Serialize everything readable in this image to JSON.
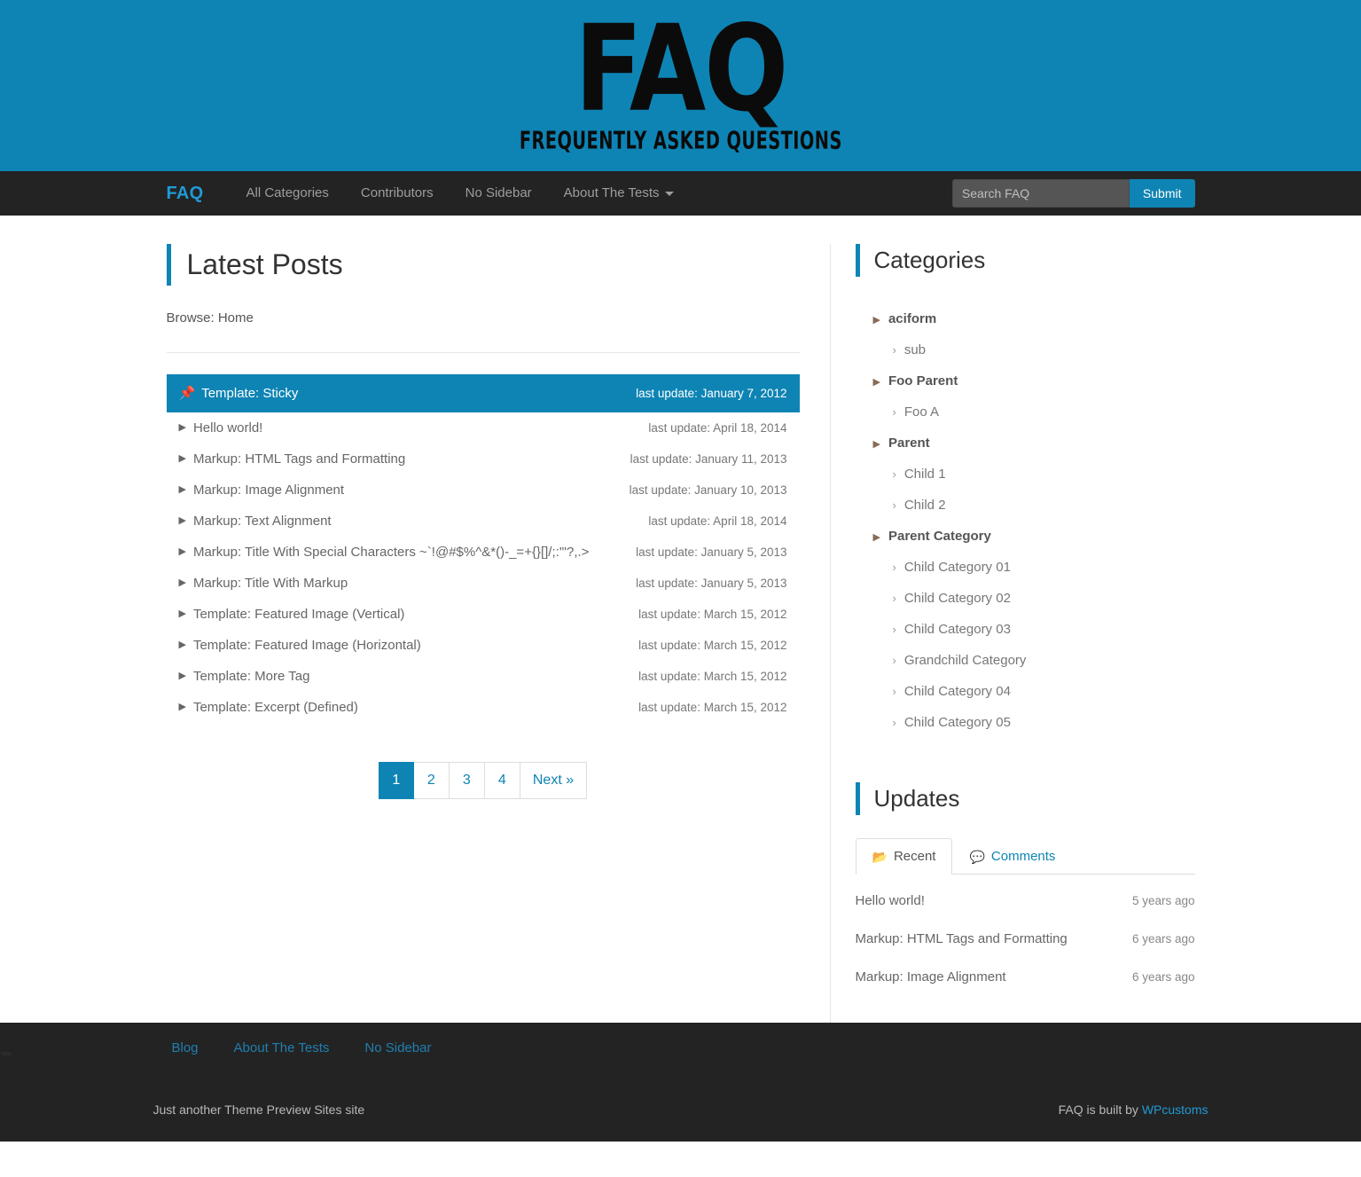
{
  "masthead": {
    "logo_text": "FAQ",
    "logo_subtitle": "FREQUENTLY ASKED QUESTIONS",
    "background_color": "#0e84b4"
  },
  "navbar": {
    "brand": "FAQ",
    "links": [
      {
        "label": "All Categories",
        "has_caret": false
      },
      {
        "label": "Contributors",
        "has_caret": false
      },
      {
        "label": "No Sidebar",
        "has_caret": false
      },
      {
        "label": "About The Tests",
        "has_caret": true
      }
    ],
    "search": {
      "placeholder": "Search FAQ",
      "value": "",
      "submit_label": "Submit"
    }
  },
  "main": {
    "title": "Latest Posts",
    "breadcrumb": "Browse: Home",
    "posts": [
      {
        "title": "Template: Sticky",
        "date": "last update: January 7, 2012",
        "sticky": true,
        "icon": "thumbtack-icon"
      },
      {
        "title": "Hello world!",
        "date": "last update: April 18, 2014",
        "sticky": false,
        "icon": "caret-right-icon"
      },
      {
        "title": "Markup: HTML Tags and Formatting",
        "date": "last update: January 11, 2013",
        "sticky": false,
        "icon": "caret-right-icon"
      },
      {
        "title": "Markup: Image Alignment",
        "date": "last update: January 10, 2013",
        "sticky": false,
        "icon": "caret-right-icon"
      },
      {
        "title": "Markup: Text Alignment",
        "date": "last update: April 18, 2014",
        "sticky": false,
        "icon": "caret-right-icon"
      },
      {
        "title": "Markup: Title With Special Characters ~`!@#$%^&*()-_=+{}[]/;:'\"?,.>",
        "date": "last update: January 5, 2013",
        "sticky": false,
        "icon": "caret-right-icon"
      },
      {
        "title": "Markup: Title With Markup",
        "date": "last update: January 5, 2013",
        "sticky": false,
        "icon": "caret-right-icon"
      },
      {
        "title": "Template: Featured Image (Vertical)",
        "date": "last update: March 15, 2012",
        "sticky": false,
        "icon": "caret-right-icon"
      },
      {
        "title": "Template: Featured Image (Horizontal)",
        "date": "last update: March 15, 2012",
        "sticky": false,
        "icon": "caret-right-icon"
      },
      {
        "title": "Template: More Tag",
        "date": "last update: March 15, 2012",
        "sticky": false,
        "icon": "caret-right-icon"
      },
      {
        "title": "Template: Excerpt (Defined)",
        "date": "last update: March 15, 2012",
        "sticky": false,
        "icon": "caret-right-icon"
      }
    ],
    "pagination": [
      {
        "label": "1",
        "active": true
      },
      {
        "label": "2",
        "active": false
      },
      {
        "label": "3",
        "active": false
      },
      {
        "label": "4",
        "active": false
      },
      {
        "label": "Next »",
        "active": false
      }
    ]
  },
  "sidebar": {
    "categories": {
      "title": "Categories",
      "items": [
        {
          "label": "aciform",
          "level": 0
        },
        {
          "label": "sub",
          "level": 1
        },
        {
          "label": "Foo Parent",
          "level": 0
        },
        {
          "label": "Foo A",
          "level": 1
        },
        {
          "label": "Parent",
          "level": 0
        },
        {
          "label": "Child 1",
          "level": 1
        },
        {
          "label": "Child 2",
          "level": 1
        },
        {
          "label": "Parent Category",
          "level": 0
        },
        {
          "label": "Child Category 01",
          "level": 1
        },
        {
          "label": "Child Category 02",
          "level": 1
        },
        {
          "label": "Child Category 03",
          "level": 1
        },
        {
          "label": "Grandchild Category",
          "level": 1
        },
        {
          "label": "Child Category 04",
          "level": 1
        },
        {
          "label": "Child Category 05",
          "level": 1
        }
      ]
    },
    "updates": {
      "title": "Updates",
      "tabs": [
        {
          "label": "Recent",
          "icon": "folder-open-icon",
          "active": true
        },
        {
          "label": "Comments",
          "icon": "comments-icon",
          "active": false
        }
      ],
      "items": [
        {
          "title": "Hello world!",
          "time": "5 years ago"
        },
        {
          "title": "Markup: HTML Tags and Formatting",
          "time": "6 years ago"
        },
        {
          "title": "Markup: Image Alignment",
          "time": "6 years ago"
        }
      ]
    }
  },
  "footer": {
    "links": [
      {
        "label": "Blog"
      },
      {
        "label": "About The Tests"
      },
      {
        "label": "No Sidebar"
      }
    ],
    "tagline": "Just another Theme Preview Sites site",
    "credit_prefix": "FAQ is built by ",
    "credit_link": "WPcustoms"
  },
  "accent_color": "#0e84b4"
}
